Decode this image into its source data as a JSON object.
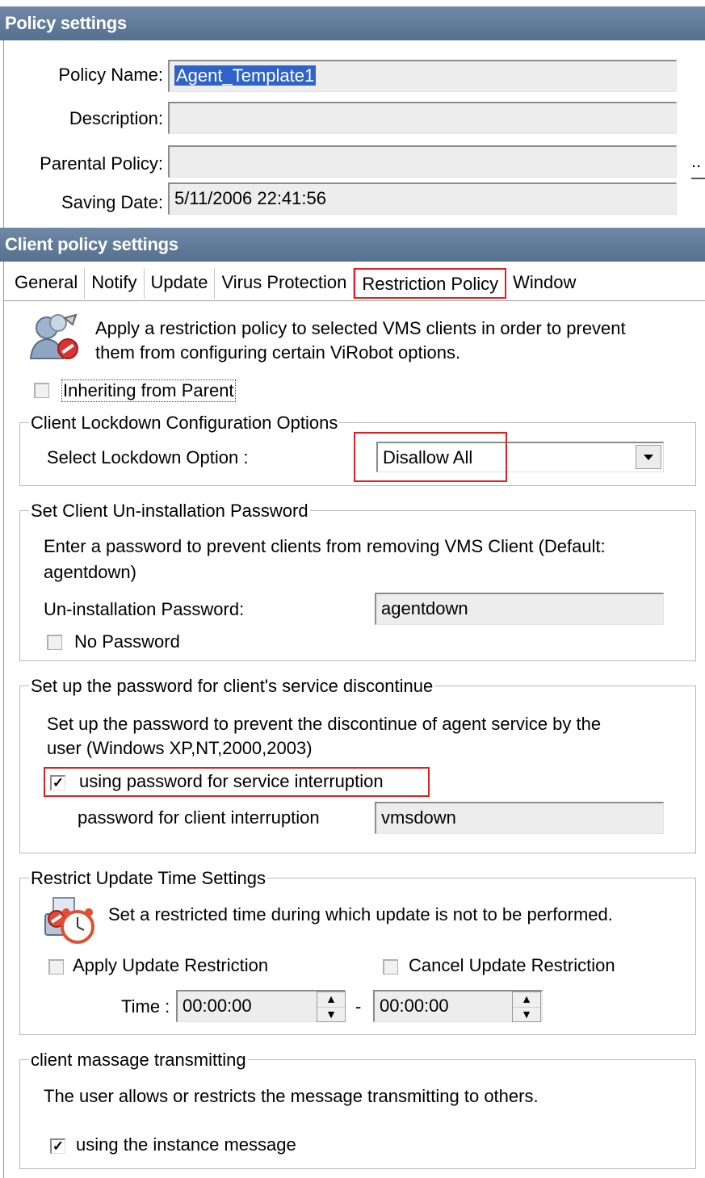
{
  "policy_section": {
    "title": "Policy settings",
    "policy_name_label": "Policy Name:",
    "policy_name_value": "Agent_Template1",
    "description_label": "Description:",
    "description_value": "",
    "parental_label": "Parental Policy:",
    "parental_value": "",
    "browse_label": "..",
    "saving_date_label": "Saving Date:",
    "saving_date_value": "5/11/2006 22:41:56"
  },
  "client_section": {
    "title": "Client policy settings",
    "tabs": [
      {
        "label": "General"
      },
      {
        "label": "Notify"
      },
      {
        "label": "Update"
      },
      {
        "label": "Virus Protection"
      },
      {
        "label": "Restriction Policy"
      },
      {
        "label": "Window"
      }
    ],
    "active_tab": "Restriction Policy"
  },
  "restriction": {
    "intro_line1": "Apply a restriction policy to selected VMS clients in order to prevent",
    "intro_line2": "them from configuring certain ViRobot options.",
    "inherit_label": "Inheriting from Parent",
    "inherit_checked": false
  },
  "lockdown": {
    "legend": "Client Lockdown Configuration Options",
    "select_label": "Select Lockdown Option :",
    "selected_value": "Disallow All"
  },
  "uninstall": {
    "legend": "Set Client Un-installation Password",
    "desc_line1": "Enter a password to prevent clients from removing VMS Client (Default:",
    "desc_line2": "agentdown)",
    "password_label": "Un-installation Password:",
    "password_value": "agentdown",
    "no_password_label": "No Password",
    "no_password_checked": false
  },
  "service": {
    "legend": "Set up the password for client's service discontinue",
    "desc_line1": "Set up the password to prevent the discontinue of agent service by the",
    "desc_line2": "user (Windows XP,NT,2000,2003)",
    "use_password_label": "using password for service interruption",
    "use_password_checked": true,
    "password_label": "password for client interruption",
    "password_value": "vmsdown"
  },
  "update_time": {
    "legend": "Restrict Update Time Settings",
    "desc": "Set a restricted time during which update is not to be performed.",
    "apply_label": "Apply Update Restriction",
    "apply_checked": false,
    "cancel_label": "Cancel Update Restriction",
    "cancel_checked": false,
    "time_label": "Time :",
    "time_from": "00:00:00",
    "time_separator": "-",
    "time_to": "00:00:00"
  },
  "message": {
    "legend": "client massage transmitting",
    "desc": "The user allows or restricts the message transmitting to others.",
    "instance_label": "using the instance message",
    "instance_checked": true
  },
  "colors": {
    "header_bg": "#5f7a99",
    "highlight": "#e02020",
    "selection": "#2f63c8"
  }
}
